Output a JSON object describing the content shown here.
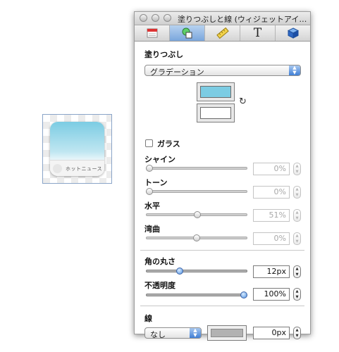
{
  "preview": {
    "widget_label": "ホットニュース",
    "apple_glyph": "",
    "gradient_top": "#7ccce3"
  },
  "window": {
    "title": "塗りつぶしと線 (ウィジェットアイ…"
  },
  "toolbar": {
    "tabs": [
      {
        "icon": "calendar-icon"
      },
      {
        "icon": "shapes-icon",
        "active": true
      },
      {
        "icon": "ruler-icon"
      },
      {
        "icon": "text-icon",
        "glyph": "T"
      },
      {
        "icon": "cube-icon"
      }
    ]
  },
  "fill": {
    "heading": "塗りつぶし",
    "type_popup": "グラデーション",
    "start_color": "#7ccce3",
    "end_color": "#ffffff",
    "swap_glyph": "↻",
    "glass_label": "ガラス",
    "glass_checked": false
  },
  "shine": {
    "label": "シャイン",
    "value": "0%",
    "level": 0.0
  },
  "tone": {
    "label": "トーン",
    "value": "0%",
    "level": 0.0
  },
  "horizontal": {
    "label": "水平",
    "value": "51%",
    "level": 0.51
  },
  "curve": {
    "label": "湾曲",
    "value": "0%",
    "level": 0.5
  },
  "corner": {
    "label": "角の丸さ",
    "value": "12px",
    "level": 0.32
  },
  "opacity": {
    "label": "不透明度",
    "value": "100%",
    "level": 1.0
  },
  "stroke": {
    "heading": "線",
    "type_popup": "なし",
    "color": "#b2b2b2",
    "width_value": "0px"
  },
  "stepper_glyphs": {
    "up": "▲",
    "down": "▼"
  },
  "popup_arrow_glyphs": {
    "up": "▲",
    "down": "▼"
  }
}
